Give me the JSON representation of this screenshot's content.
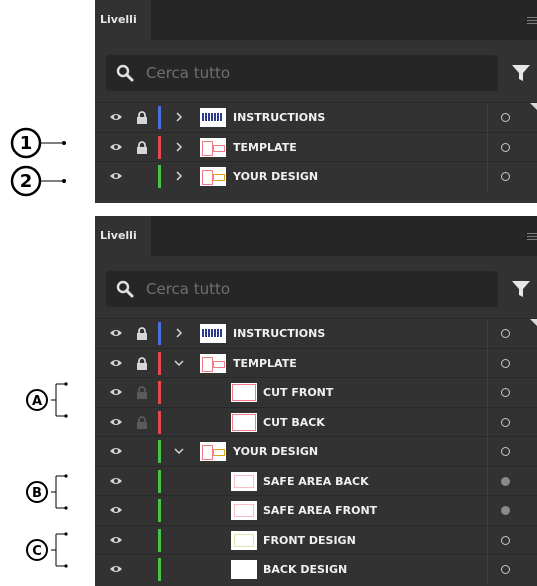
{
  "panels": [
    {
      "tab_label": "Livelli",
      "search_placeholder": "Cerca tutto",
      "rows": [
        {
          "name": "INSTRUCTIONS",
          "color": "#4a6fd8",
          "locked": true,
          "expand": "collapsed",
          "indent": 0,
          "thumb": "instructions"
        },
        {
          "name": "TEMPLATE",
          "color": "#e8474f",
          "locked": true,
          "expand": "collapsed",
          "indent": 0,
          "thumb": "template"
        },
        {
          "name": "YOUR DESIGN",
          "color": "#47c447",
          "locked": false,
          "expand": "collapsed",
          "indent": 0,
          "thumb": "design"
        }
      ]
    },
    {
      "tab_label": "Livelli",
      "search_placeholder": "Cerca tutto",
      "rows": [
        {
          "name": "INSTRUCTIONS",
          "color": "#4a6fd8",
          "locked": true,
          "expand": "collapsed",
          "indent": 0,
          "thumb": "instructions"
        },
        {
          "name": "TEMPLATE",
          "color": "#e8474f",
          "locked": true,
          "expand": "expanded",
          "indent": 0,
          "thumb": "template"
        },
        {
          "name": "CUT FRONT",
          "color": "#e8474f",
          "locked": "dim",
          "expand": "none",
          "indent": 1,
          "thumb": "pink"
        },
        {
          "name": "CUT BACK",
          "color": "#e8474f",
          "locked": "dim",
          "expand": "none",
          "indent": 1,
          "thumb": "pink"
        },
        {
          "name": "YOUR DESIGN",
          "color": "#47c447",
          "locked": false,
          "expand": "expanded",
          "indent": 0,
          "thumb": "design"
        },
        {
          "name": "SAFE AREA BACK",
          "color": "#47c447",
          "locked": false,
          "expand": "none",
          "indent": 1,
          "thumb": "pink2",
          "filled": true
        },
        {
          "name": "SAFE AREA FRONT",
          "color": "#47c447",
          "locked": false,
          "expand": "none",
          "indent": 1,
          "thumb": "pink2",
          "filled": true
        },
        {
          "name": "FRONT DESIGN",
          "color": "#47c447",
          "locked": false,
          "expand": "none",
          "indent": 1,
          "thumb": "green"
        },
        {
          "name": "BACK DESIGN",
          "color": "#47c447",
          "locked": false,
          "expand": "none",
          "indent": 1,
          "thumb": "white"
        }
      ]
    }
  ],
  "callouts": [
    "1",
    "2",
    "A",
    "B",
    "C"
  ]
}
